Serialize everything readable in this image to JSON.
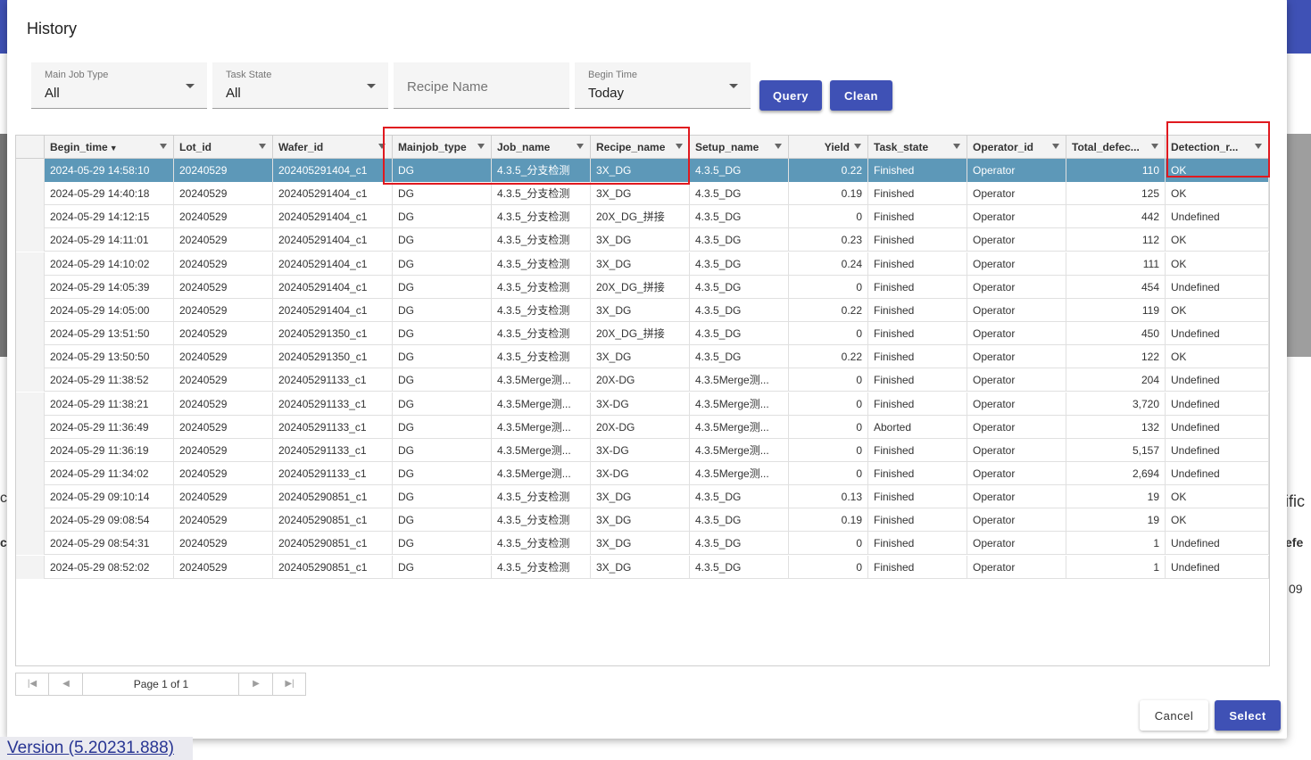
{
  "dialog": {
    "title": "History"
  },
  "filters": {
    "main_job_type": {
      "label": "Main Job Type",
      "value": "All"
    },
    "task_state": {
      "label": "Task State",
      "value": "All"
    },
    "recipe_name": {
      "placeholder": "Recipe Name"
    },
    "begin_time": {
      "label": "Begin Time",
      "value": "Today"
    }
  },
  "buttons": {
    "query": "Query",
    "clean": "Clean",
    "cancel": "Cancel",
    "select": "Select"
  },
  "grid": {
    "columns": [
      "Begin_time",
      "Lot_id",
      "Wafer_id",
      "Mainjob_type",
      "Job_name",
      "Recipe_name",
      "Setup_name",
      "Yield",
      "Task_state",
      "Operator_id",
      "Total_defec...",
      "Detection_r..."
    ],
    "sort_indicator": "▼",
    "rows": [
      [
        "2024-05-29 14:58:10",
        "20240529",
        "202405291404_c1",
        "DG",
        "4.3.5_分支检测",
        "3X_DG",
        "4.3.5_DG",
        "0.22",
        "Finished",
        "Operator",
        "110",
        "OK"
      ],
      [
        "2024-05-29 14:40:18",
        "20240529",
        "202405291404_c1",
        "DG",
        "4.3.5_分支检测",
        "3X_DG",
        "4.3.5_DG",
        "0.19",
        "Finished",
        "Operator",
        "125",
        "OK"
      ],
      [
        "2024-05-29 14:12:15",
        "20240529",
        "202405291404_c1",
        "DG",
        "4.3.5_分支检测",
        "20X_DG_拼接",
        "4.3.5_DG",
        "0",
        "Finished",
        "Operator",
        "442",
        "Undefined"
      ],
      [
        "2024-05-29 14:11:01",
        "20240529",
        "202405291404_c1",
        "DG",
        "4.3.5_分支检测",
        "3X_DG",
        "4.3.5_DG",
        "0.23",
        "Finished",
        "Operator",
        "112",
        "OK"
      ],
      [
        "2024-05-29 14:10:02",
        "20240529",
        "202405291404_c1",
        "DG",
        "4.3.5_分支检测",
        "3X_DG",
        "4.3.5_DG",
        "0.24",
        "Finished",
        "Operator",
        "111",
        "OK"
      ],
      [
        "2024-05-29 14:05:39",
        "20240529",
        "202405291404_c1",
        "DG",
        "4.3.5_分支检测",
        "20X_DG_拼接",
        "4.3.5_DG",
        "0",
        "Finished",
        "Operator",
        "454",
        "Undefined"
      ],
      [
        "2024-05-29 14:05:00",
        "20240529",
        "202405291404_c1",
        "DG",
        "4.3.5_分支检测",
        "3X_DG",
        "4.3.5_DG",
        "0.22",
        "Finished",
        "Operator",
        "119",
        "OK"
      ],
      [
        "2024-05-29 13:51:50",
        "20240529",
        "202405291350_c1",
        "DG",
        "4.3.5_分支检测",
        "20X_DG_拼接",
        "4.3.5_DG",
        "0",
        "Finished",
        "Operator",
        "450",
        "Undefined"
      ],
      [
        "2024-05-29 13:50:50",
        "20240529",
        "202405291350_c1",
        "DG",
        "4.3.5_分支检测",
        "3X_DG",
        "4.3.5_DG",
        "0.22",
        "Finished",
        "Operator",
        "122",
        "OK"
      ],
      [
        "2024-05-29 11:38:52",
        "20240529",
        "202405291133_c1",
        "DG",
        "4.3.5Merge测...",
        "20X-DG",
        "4.3.5Merge测...",
        "0",
        "Finished",
        "Operator",
        "204",
        "Undefined"
      ],
      [
        "2024-05-29 11:38:21",
        "20240529",
        "202405291133_c1",
        "DG",
        "4.3.5Merge测...",
        "3X-DG",
        "4.3.5Merge测...",
        "0",
        "Finished",
        "Operator",
        "3,720",
        "Undefined"
      ],
      [
        "2024-05-29 11:36:49",
        "20240529",
        "202405291133_c1",
        "DG",
        "4.3.5Merge测...",
        "20X-DG",
        "4.3.5Merge测...",
        "0",
        "Aborted",
        "Operator",
        "132",
        "Undefined"
      ],
      [
        "2024-05-29 11:36:19",
        "20240529",
        "202405291133_c1",
        "DG",
        "4.3.5Merge测...",
        "3X-DG",
        "4.3.5Merge测...",
        "0",
        "Finished",
        "Operator",
        "5,157",
        "Undefined"
      ],
      [
        "2024-05-29 11:34:02",
        "20240529",
        "202405291133_c1",
        "DG",
        "4.3.5Merge测...",
        "3X-DG",
        "4.3.5Merge测...",
        "0",
        "Finished",
        "Operator",
        "2,694",
        "Undefined"
      ],
      [
        "2024-05-29 09:10:14",
        "20240529",
        "202405290851_c1",
        "DG",
        "4.3.5_分支检测",
        "3X_DG",
        "4.3.5_DG",
        "0.13",
        "Finished",
        "Operator",
        "19",
        "OK"
      ],
      [
        "2024-05-29 09:08:54",
        "20240529",
        "202405290851_c1",
        "DG",
        "4.3.5_分支检测",
        "3X_DG",
        "4.3.5_DG",
        "0.19",
        "Finished",
        "Operator",
        "19",
        "OK"
      ],
      [
        "2024-05-29 08:54:31",
        "20240529",
        "202405290851_c1",
        "DG",
        "4.3.5_分支检测",
        "3X_DG",
        "4.3.5_DG",
        "0",
        "Finished",
        "Operator",
        "1",
        "Undefined"
      ],
      [
        "2024-05-29 08:52:02",
        "20240529",
        "202405290851_c1",
        "DG",
        "4.3.5_分支检测",
        "3X_DG",
        "4.3.5_DG",
        "0",
        "Finished",
        "Operator",
        "1",
        "Undefined"
      ]
    ],
    "selected_row": 0
  },
  "pager": {
    "text": "Page 1 of 1"
  },
  "version": {
    "text": "Version (5.20231.888)"
  },
  "background": {
    "right_text_1": "ific",
    "right_text_2": "efe",
    "right_text_3": "09",
    "left_text_1": "c",
    "left_text_2": "c"
  },
  "colors": {
    "primary": "#3f51b5",
    "selected_row": "#5d98b8",
    "highlight": "#e0191f"
  },
  "icons": {
    "dropdown": "caret-down-icon",
    "filter": "filter-icon",
    "pager_first": "first-page-icon",
    "pager_prev": "prev-page-icon",
    "pager_next": "next-page-icon",
    "pager_last": "last-page-icon"
  }
}
